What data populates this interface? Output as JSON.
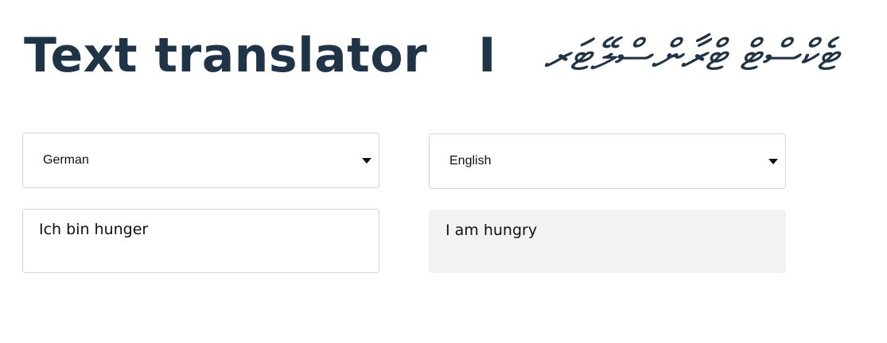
{
  "header": {
    "title_en": "Text translator",
    "separator": "I",
    "title_dv": "ޓެކްސްޓް ޓްރާންސްލޭޓަރ"
  },
  "source": {
    "language": "German",
    "text": "Ich bin hunger"
  },
  "target": {
    "language": "English",
    "text": "I am hungry"
  },
  "icons": {
    "dropdown": "caret-down-icon"
  },
  "colors": {
    "title": "#1f3447",
    "output_bg": "#f2f2f2",
    "border": "#d4d4d4"
  }
}
